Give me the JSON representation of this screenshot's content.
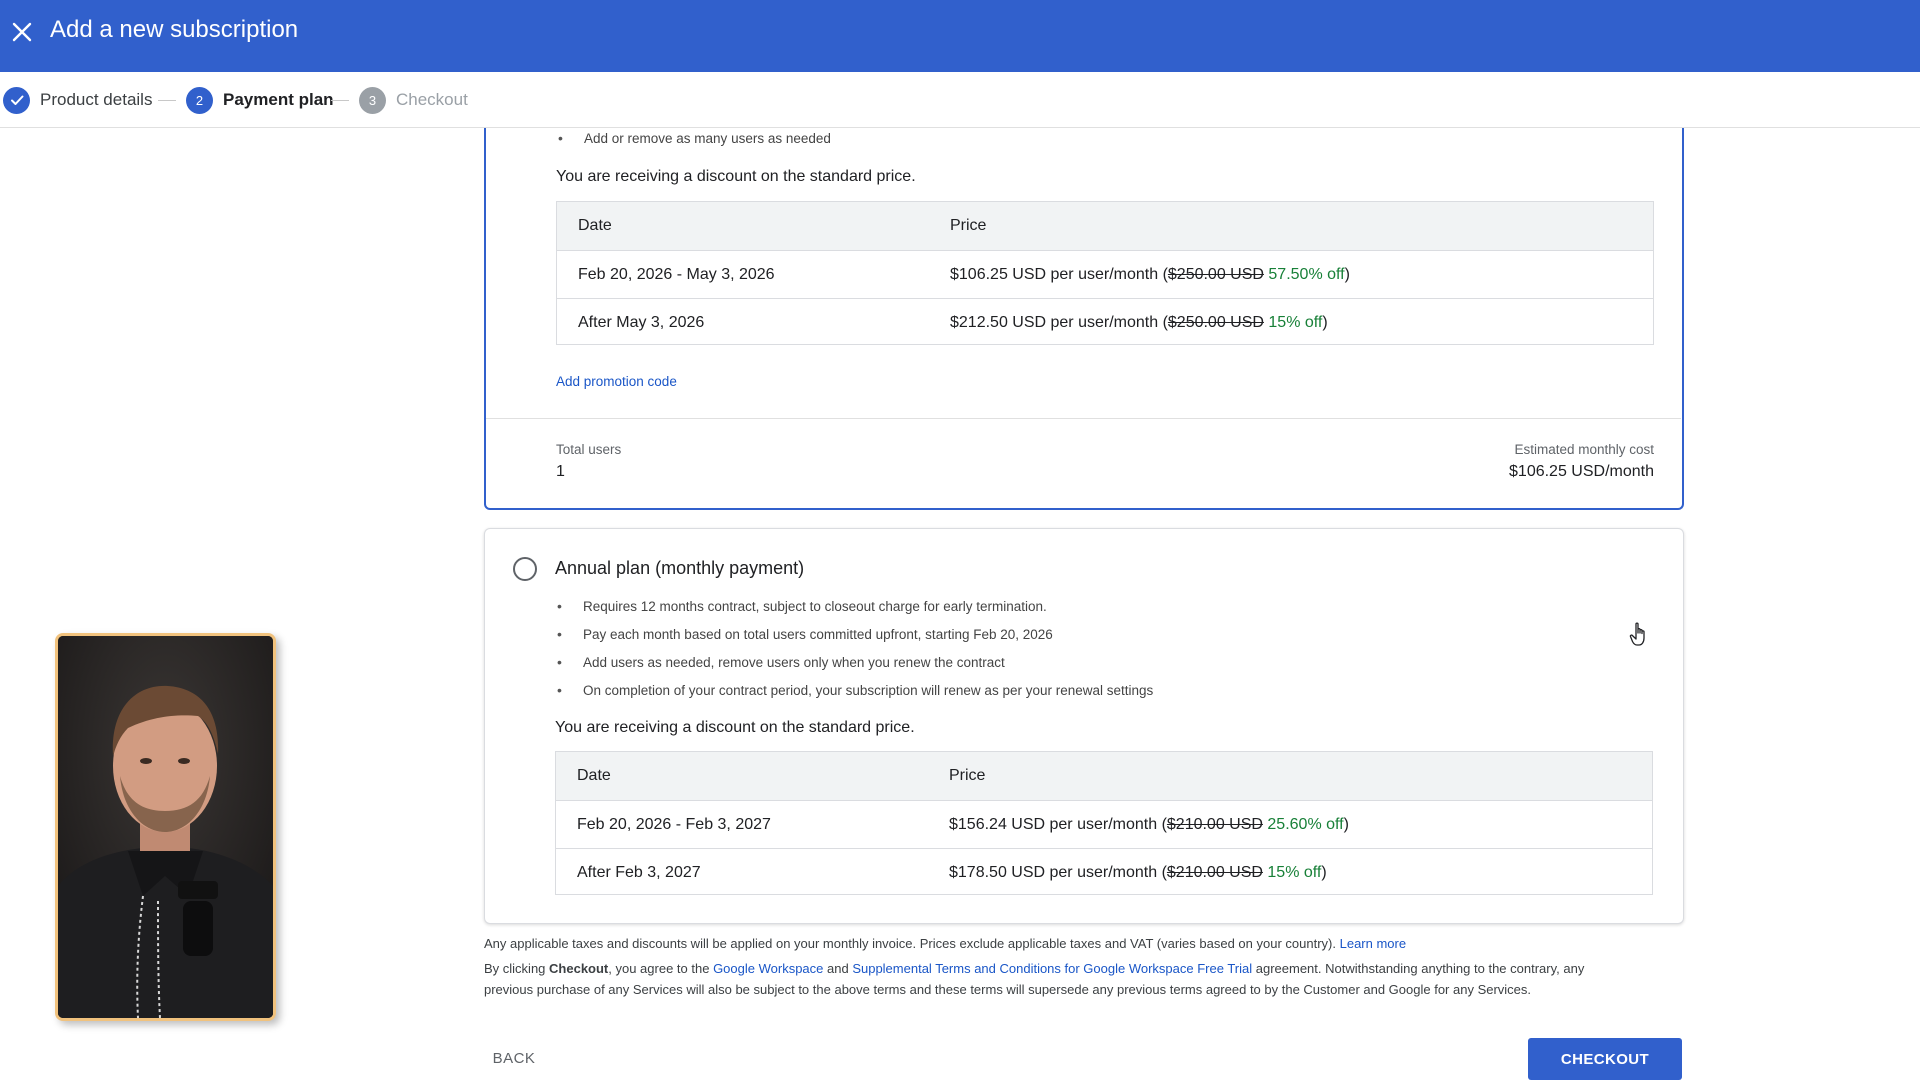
{
  "header": {
    "title": "Add a new subscription"
  },
  "stepper": {
    "steps": [
      {
        "label": "Product details",
        "number": "",
        "state": "done"
      },
      {
        "label": "Payment plan",
        "number": "2",
        "state": "active"
      },
      {
        "label": "Checkout",
        "number": "3",
        "state": "pending"
      }
    ]
  },
  "flexible_plan": {
    "bullets": [
      "Add or remove as many users as needed"
    ],
    "discount_text": "You are receiving a discount on the standard price.",
    "table": {
      "headers": [
        "Date",
        "Price"
      ],
      "rows": [
        {
          "date": "Feb 20, 2026 - May 3, 2026",
          "price_pre": "$106.25 USD per user/month (",
          "price_strike": "$250.00 USD",
          "price_off": "57.50% off",
          "price_post": ")"
        },
        {
          "date": "After May 3, 2026",
          "price_pre": "$212.50 USD per user/month (",
          "price_strike": "$250.00 USD",
          "price_off": "15% off",
          "price_post": ")"
        }
      ]
    },
    "promo_link": "Add promotion code",
    "total_users_label": "Total users",
    "total_users_value": "1",
    "est_cost_label": "Estimated monthly cost",
    "est_cost_value": "$106.25 USD/month"
  },
  "annual_plan": {
    "title": "Annual plan (monthly payment)",
    "bullets": [
      "Requires 12 months contract, subject to closeout charge for early termination.",
      "Pay each month based on total users committed upfront, starting Feb 20, 2026",
      "Add users as needed, remove users only when you renew the contract",
      "On completion of your contract period, your subscription will renew as per your renewal settings"
    ],
    "discount_text": "You are receiving a discount on the standard price.",
    "table": {
      "headers": [
        "Date",
        "Price"
      ],
      "rows": [
        {
          "date": "Feb 20, 2026 - Feb 3, 2027",
          "price_pre": "$156.24 USD per user/month (",
          "price_strike": "$210.00 USD",
          "price_off": "25.60% off",
          "price_post": ")"
        },
        {
          "date": "After Feb 3, 2027",
          "price_pre": "$178.50 USD per user/month (",
          "price_strike": "$210.00 USD",
          "price_off": "15% off",
          "price_post": ")"
        }
      ]
    }
  },
  "footer": {
    "tax_text": "Any applicable taxes and discounts will be applied on your monthly invoice. Prices exclude applicable taxes and VAT (varies based on your country).",
    "learn_more": "Learn more",
    "agree_1": "By clicking ",
    "agree_bold": "Checkout",
    "agree_2": ", you agree to the ",
    "link_workspace": "Google Workspace",
    "agree_3": " and ",
    "link_terms": "Supplemental Terms and Conditions for Google Workspace Free Trial",
    "agree_4": " agreement. Notwithstanding anything to the contrary, any",
    "agree_line2": "previous purchase of any Services will also be subject to the above terms and these terms will supersede any previous terms agreed to by the Customer and Google for any Services."
  },
  "buttons": {
    "back": "BACK",
    "checkout": "CHECKOUT"
  },
  "colors": {
    "primary": "#3160cc",
    "discount_green": "#188038",
    "link": "#1a56c7"
  },
  "icons": {
    "close": "close-icon",
    "check": "check-icon",
    "pointer": "hand-pointer-icon"
  }
}
